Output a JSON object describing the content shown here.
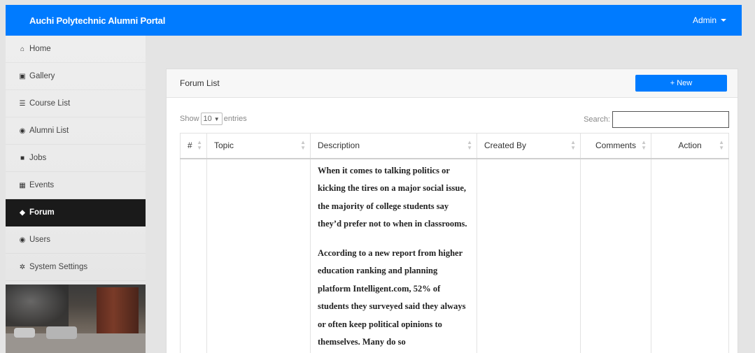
{
  "navbar": {
    "brand": "Auchi Polytechnic Alumni Portal",
    "user_label": "Admin",
    "color": "#007bff"
  },
  "sidebar": {
    "items": [
      {
        "label": "Home",
        "icon": "home-icon",
        "glyph": "⌂"
      },
      {
        "label": "Gallery",
        "icon": "image-icon",
        "glyph": "▣"
      },
      {
        "label": "Course List",
        "icon": "list-icon",
        "glyph": "☰"
      },
      {
        "label": "Alumni List",
        "icon": "users-icon",
        "glyph": "◉"
      },
      {
        "label": "Jobs",
        "icon": "briefcase-icon",
        "glyph": "■"
      },
      {
        "label": "Events",
        "icon": "calendar-icon",
        "glyph": "▦"
      },
      {
        "label": "Forum",
        "icon": "comments-icon",
        "glyph": "◆",
        "active": true
      },
      {
        "label": "Users",
        "icon": "users-cog-icon",
        "glyph": "◉"
      },
      {
        "label": "System Settings",
        "icon": "cogs-icon",
        "glyph": "✲"
      }
    ]
  },
  "card": {
    "title": "Forum List",
    "new_button": "New",
    "show_label": "Show",
    "entries_value": "10",
    "entries_label": "entries",
    "search_label": "Search:",
    "search_value": ""
  },
  "table": {
    "columns": [
      "#",
      "Topic",
      "Description",
      "Created By",
      "Comments",
      "Action"
    ],
    "rows": [
      {
        "number": "",
        "topic": "",
        "description": [
          "When it comes to talking politics or kicking the tires on a major social issue, the majority of college students say they’d prefer not to when in classrooms.",
          "According to a new report from higher education ranking and planning platform Intelligent.com, 52% of students they surveyed said they always or often keep political opinions to themselves. Many do so"
        ],
        "created_by": "",
        "comments": "",
        "action": ""
      }
    ]
  }
}
